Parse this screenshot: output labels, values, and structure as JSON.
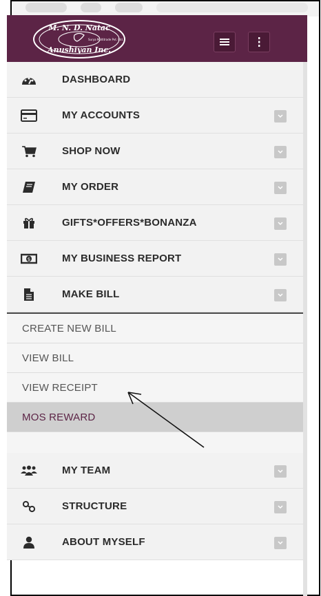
{
  "brand": {
    "logo_text_top": "M. N. D. Natac",
    "logo_text_bottom": "Anushiyan Inc.",
    "logo_small_text": "Surya Multitrade Pvt. Ltd.",
    "header_color": "#5c2446"
  },
  "header": {
    "menu_icon": "hamburger-icon",
    "more_icon": "vertical-dots-icon"
  },
  "menu": {
    "items": [
      {
        "label": "DASHBOARD",
        "icon": "dashboard-gauge-icon",
        "has_chevron": false
      },
      {
        "label": "MY ACCOUNTS",
        "icon": "credit-card-icon",
        "has_chevron": true
      },
      {
        "label": "SHOP NOW",
        "icon": "shopping-cart-icon",
        "has_chevron": true
      },
      {
        "label": "MY ORDER",
        "icon": "book-icon",
        "has_chevron": true
      },
      {
        "label": "GIFTS*OFFERS*BONANZA",
        "icon": "gift-icon",
        "has_chevron": true
      },
      {
        "label": "MY BUSINESS REPORT",
        "icon": "money-icon",
        "has_chevron": true
      },
      {
        "label": "MAKE BILL",
        "icon": "document-icon",
        "has_chevron": true
      }
    ],
    "submenu": [
      {
        "label": "CREATE NEW BILL"
      },
      {
        "label": "VIEW BILL"
      },
      {
        "label": "VIEW RECEIPT"
      },
      {
        "label": "MOS REWARD",
        "active": true
      }
    ],
    "items_after": [
      {
        "label": "MY TEAM",
        "icon": "users-icon",
        "has_chevron": true
      },
      {
        "label": "STRUCTURE",
        "icon": "link-icon",
        "has_chevron": true
      },
      {
        "label": "ABOUT MYSELF",
        "icon": "user-icon",
        "has_chevron": true
      }
    ]
  },
  "annotation": {
    "arrow_icon": "annotation-arrow-icon"
  }
}
